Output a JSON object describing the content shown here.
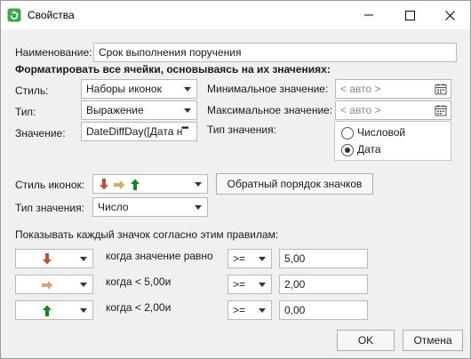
{
  "window": {
    "title": "Свойства"
  },
  "name_label": "Наименование:",
  "name_value": "Срок выполнения поручения",
  "format_heading": "Форматировать все ячейки, основываясь на их значениях:",
  "style_label": "Стиль:",
  "style_value": "Наборы иконок",
  "type_label": "Тип:",
  "type_value": "Выражение",
  "value_label": "Значение:",
  "value_value": "DateDiffDay([Дата н",
  "value_more": "•••",
  "min_label": "Минимальное значение:",
  "min_placeholder": "< авто >",
  "max_label": "Максимальное значение:",
  "max_placeholder": "< авто >",
  "value_type_label": "Тип значения:",
  "value_type_options": [
    "Числовой",
    "Дата"
  ],
  "value_type_selected": "Дата",
  "icon_style_label": "Стиль иконок:",
  "reverse_button": "Обратный порядок значков",
  "value_type2_label": "Тип значения:",
  "value_type2_value": "Число",
  "rules_heading": "Показывать каждый значок согласно этим правилам:",
  "rules": [
    {
      "icon": "arrow-down-icon",
      "color": "#c0502e",
      "condition": "когда значение равно",
      "operator": ">=",
      "value": "5,00"
    },
    {
      "icon": "arrow-right-icon",
      "color": "#d9a66b",
      "condition": "когда < 5,00и",
      "operator": ">=",
      "value": "2,00"
    },
    {
      "icon": "arrow-up-icon",
      "color": "#0b8a1f",
      "condition": "когда < 2,00и",
      "operator": ">=",
      "value": "0,00"
    }
  ],
  "ok_button": "OK",
  "cancel_button": "Отмена"
}
